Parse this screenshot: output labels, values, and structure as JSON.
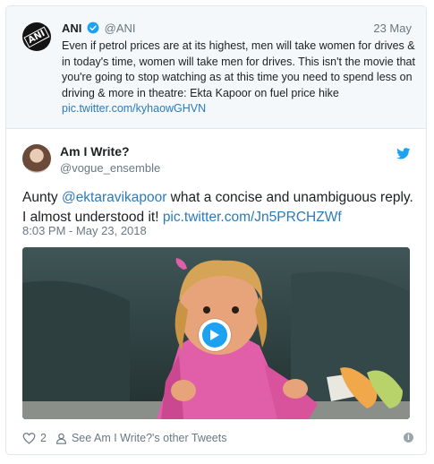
{
  "quoted_tweet": {
    "avatar_text": "ANI",
    "name": "ANI",
    "handle": "@ANI",
    "date": "23 May",
    "text": "Even if petrol prices are at its highest, men will take women for drives & in today's time, women will take men for drives. This isn't the movie that you're going to stop watching as at this time you need to spend less on driving & more in theatre: Ekta Kapoor on fuel price hike",
    "link": "pic.twitter.com/kyhaowGHVN"
  },
  "tweet": {
    "author_name": "Am I Write?",
    "author_handle": "@vogue_ensemble",
    "text_prefix": "Aunty ",
    "mention": "@ektaravikapoor",
    "text_middle": " what a concise and unambiguous reply. I almost understood it! ",
    "link": "pic.twitter.com/Jn5PRCHZWf",
    "timestamp": "8:03 PM - May 23, 2018"
  },
  "footer": {
    "like_count": "2",
    "other_tweets": "See Am I Write?'s other Tweets"
  },
  "colors": {
    "accent": "#1da1f2",
    "link": "#2b7bb9",
    "muted": "#697882"
  },
  "icons": [
    "verified-icon",
    "twitter-bird-icon",
    "play-icon",
    "heart-icon",
    "person-icon",
    "info-icon"
  ]
}
